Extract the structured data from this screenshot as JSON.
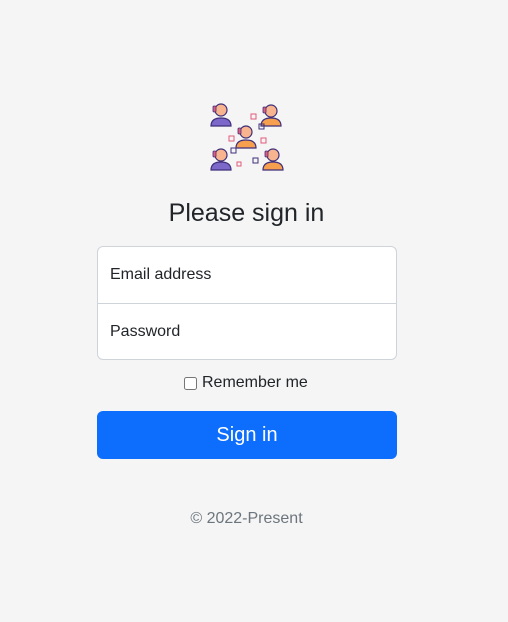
{
  "logo": {
    "icon": "team-network-icon"
  },
  "title": "Please sign in",
  "form": {
    "email_placeholder": "Email address",
    "email_value": "",
    "password_placeholder": "Password",
    "password_value": "",
    "remember_label": "Remember me",
    "remember_checked": false,
    "submit_label": "Sign in"
  },
  "footer": {
    "text": "© 2022-Present"
  },
  "colors": {
    "background": "#f5f5f5",
    "primary": "#0d6efd",
    "muted": "#6c757d",
    "icon_purple": "#5b4aa8",
    "icon_orange": "#f59f4f",
    "icon_skin": "#f7b48e",
    "icon_pink": "#e05c7c"
  }
}
